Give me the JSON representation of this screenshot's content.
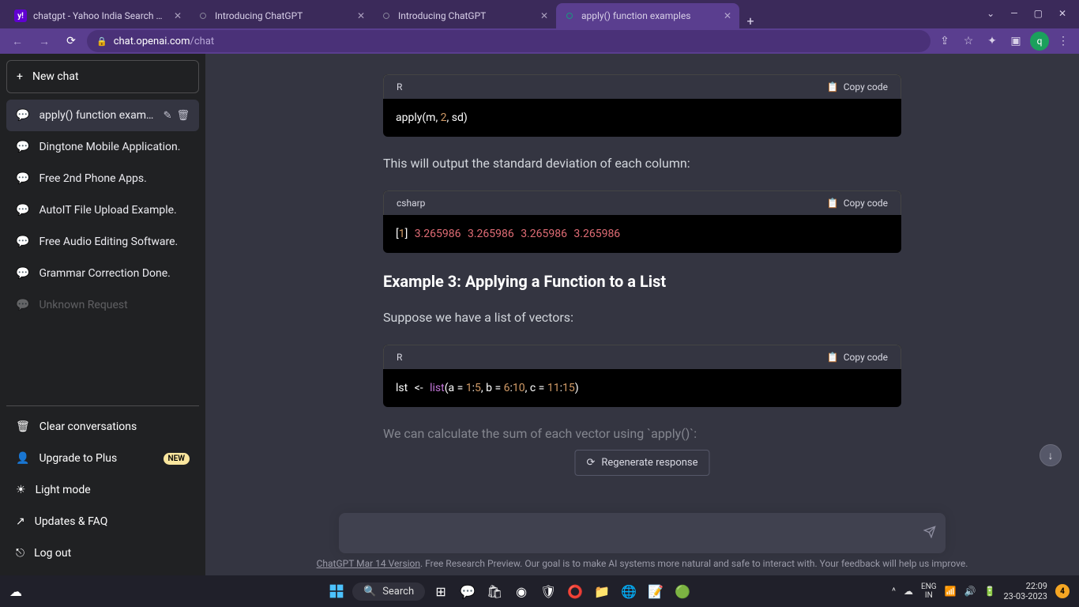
{
  "browser": {
    "tabs": [
      {
        "title": "chatgpt - Yahoo India Search Results",
        "favicon": "yahoo"
      },
      {
        "title": "Introducing ChatGPT",
        "favicon": "openai"
      },
      {
        "title": "Introducing ChatGPT",
        "favicon": "openai"
      },
      {
        "title": "apply() function examples",
        "favicon": "openai",
        "active": true
      }
    ],
    "url_domain": "chat.openai.com",
    "url_path": "/chat",
    "profile_letter": "q"
  },
  "sidebar": {
    "new_chat": "New chat",
    "conversations": [
      {
        "title": "apply() function exampl",
        "active": true
      },
      {
        "title": "Dingtone Mobile Application."
      },
      {
        "title": "Free 2nd Phone Apps."
      },
      {
        "title": "AutoIT File Upload Example."
      },
      {
        "title": "Free Audio Editing Software."
      },
      {
        "title": "Grammar Correction Done."
      },
      {
        "title": "Unknown Request"
      }
    ],
    "clear": "Clear conversations",
    "upgrade": "Upgrade to Plus",
    "upgrade_badge": "NEW",
    "light_mode": "Light mode",
    "updates": "Updates & FAQ",
    "logout": "Log out"
  },
  "content": {
    "code1_lang": "R",
    "copy_label": "Copy code",
    "prose1": "This will output the standard deviation of each column:",
    "code2_lang": "csharp",
    "heading3": "Example 3: Applying a Function to a List",
    "prose2": "Suppose we have a list of vectors:",
    "code3_lang": "R",
    "prose3": "We can calculate the sum of each vector using `apply()`:",
    "code_snippets": {
      "apply_sd": "apply(m, 2, sd)",
      "output_sd": "[1] 3.265986 3.265986 3.265986 3.265986",
      "list_def": "lst <- list(a = 1:5, b = 6:10, c = 11:15)"
    }
  },
  "controls": {
    "regenerate": "Regenerate response"
  },
  "footer": {
    "version_link": "ChatGPT Mar 14 Version",
    "disclaimer": ". Free Research Preview. Our goal is to make AI systems more natural and safe to interact with. Your feedback will help us improve."
  },
  "taskbar": {
    "search": "Search",
    "lang_top": "ENG",
    "lang_bot": "IN",
    "time": "22:09",
    "date": "23-03-2023"
  }
}
